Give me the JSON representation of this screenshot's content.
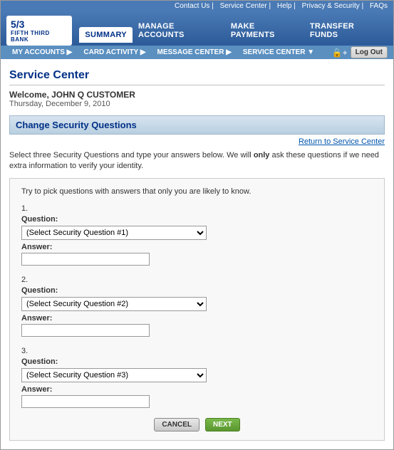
{
  "utility_nav": {
    "links": [
      "Contact Us",
      "Service Center",
      "Help",
      "Privacy & Security",
      "FAQs"
    ]
  },
  "header": {
    "logo_fraction": "5/3",
    "logo_name": "FIFTH THIRD BANK",
    "nav_items": [
      {
        "label": "SUMMARY",
        "active": false
      },
      {
        "label": "MANAGE ACCOUNTS",
        "active": false
      },
      {
        "label": "MAKE PAYMENTS",
        "active": false
      },
      {
        "label": "TRANSFER FUNDS",
        "active": false
      }
    ]
  },
  "sub_nav": {
    "items": [
      {
        "label": "MY ACCOUNTS ▶"
      },
      {
        "label": "CARD ACTIVITY ▶"
      },
      {
        "label": "MESSAGE CENTER ▶"
      },
      {
        "label": "SERVICE CENTER ▼"
      }
    ],
    "logout_label": "Log Out"
  },
  "page": {
    "title": "Service Center",
    "welcome": "Welcome, JOHN Q CUSTOMER",
    "date": "Thursday, December 9, 2010",
    "section_header": "Change Security Questions",
    "return_link": "Return to Service Center",
    "intro_line1": "Select three Security Questions and type your answers below. We will",
    "intro_bold": "only",
    "intro_line2": "ask these questions if we need extra information to verify your identity.",
    "hint": "Try to pick questions with answers that only you are likely to know.",
    "questions": [
      {
        "number": "1.",
        "question_label": "Question:",
        "placeholder": "(Select Security Question #1)",
        "answer_label": "Answer:"
      },
      {
        "number": "2.",
        "question_label": "Question:",
        "placeholder": "(Select Security Question #2)",
        "answer_label": "Answer:"
      },
      {
        "number": "3.",
        "question_label": "Question:",
        "placeholder": "(Select Security Question #3)",
        "answer_label": "Answer:"
      }
    ],
    "cancel_btn": "CANCEL",
    "next_btn": "NEXT"
  }
}
